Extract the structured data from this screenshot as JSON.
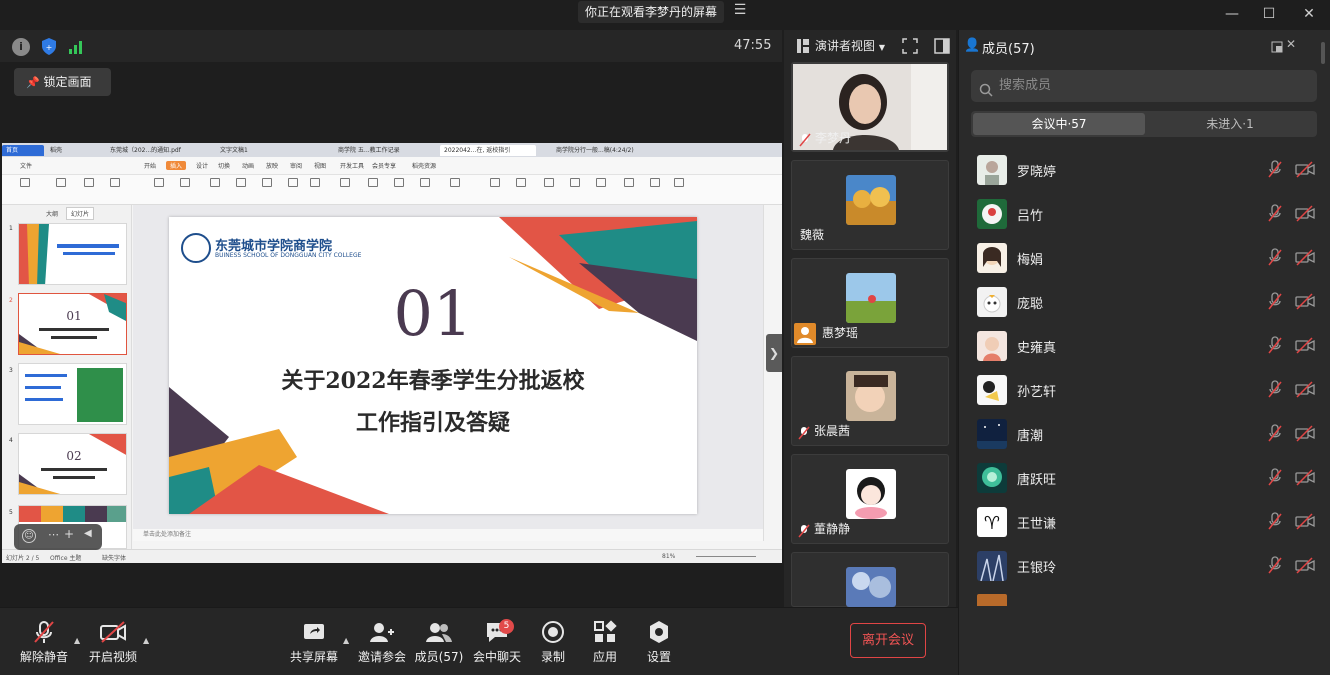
{
  "titlebar": {
    "share_banner": "你正在观看李梦丹的屏幕"
  },
  "meeting": {
    "timer": "47:55",
    "lock_label": "锁定画面"
  },
  "speaker_view": {
    "label": "演讲者视图",
    "tiles": [
      {
        "name": "李梦丹",
        "muted": true
      },
      {
        "name": "魏薇",
        "muted": false
      },
      {
        "name": "惠梦瑶",
        "muted": false
      },
      {
        "name": "张晨茜",
        "muted": true
      },
      {
        "name": "董静静",
        "muted": true
      }
    ]
  },
  "members_panel": {
    "title": "成员(57)",
    "search_placeholder": "搜索成员",
    "tabs": [
      {
        "label": "会议中·57",
        "active": true
      },
      {
        "label": "未进入·1",
        "active": false
      }
    ],
    "members": [
      {
        "name": "罗晓婷"
      },
      {
        "name": "吕竹"
      },
      {
        "name": "梅娟"
      },
      {
        "name": "庞聪"
      },
      {
        "name": "史雍真"
      },
      {
        "name": "孙艺轩"
      },
      {
        "name": "唐潮"
      },
      {
        "name": "唐跃旺"
      },
      {
        "name": "王世谦"
      },
      {
        "name": "王银玲"
      }
    ]
  },
  "toolbar": {
    "unmute": "解除静音",
    "start_video": "开启视频",
    "share_screen": "共享屏幕",
    "invite": "邀请参会",
    "members": "成员(57)",
    "chat": "会中聊天",
    "chat_badge": "5",
    "record": "录制",
    "apps": "应用",
    "settings": "设置",
    "leave": "离开会议"
  },
  "shared_screen": {
    "tabs": [
      "首页",
      "稻壳",
      "东莞城（202...的通知.pdf",
      "文字文稿1",
      "商学院 五...教工作记录",
      "2022042...在, 返校指引",
      "商学院分行一般...稿(4:24/2)"
    ],
    "menu": [
      "文件",
      "开始",
      "插入",
      "设计",
      "切换",
      "动画",
      "放映",
      "审阅",
      "视图",
      "开发工具",
      "会员专享",
      "稻壳资源"
    ],
    "slide": {
      "school_name": "东莞城市学院商学院",
      "school_name_en": "BUINESS SCHOOL OF DONGGUAN CITY COLLEGE",
      "number": "01",
      "title_line1": "关于2022年春季学生分批返校",
      "title_line2": "工作指引及答疑"
    },
    "thumbs_tabs": [
      "大纲",
      "幻灯片"
    ],
    "notes_hint": "单击此处添加备注",
    "status_left": "幻灯片 2 / 5",
    "status_theme": "Office 主题",
    "status_font": "缺失字体",
    "status_zoom": "81%"
  },
  "colors": {
    "accent_red": "#e04545",
    "slide_red": "#e25546",
    "slide_orange": "#eea431",
    "slide_teal": "#1f8c86",
    "slide_purple": "#4a3a50"
  }
}
